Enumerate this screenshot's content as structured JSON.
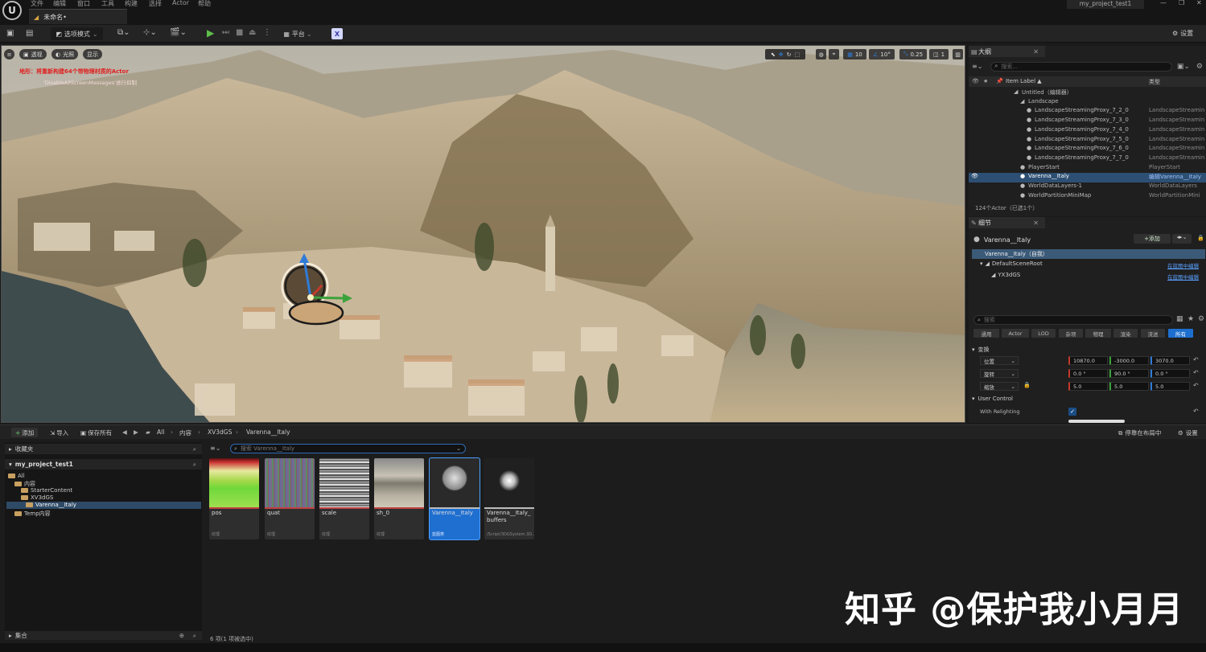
{
  "app": {
    "menu": [
      "文件",
      "编辑",
      "窗口",
      "工具",
      "构建",
      "选择",
      "Actor",
      "帮助"
    ],
    "doc_tab": "未命名•",
    "project_name": "my_project_test1",
    "window_controls": [
      "—",
      "❐",
      "✕"
    ]
  },
  "toolbar": {
    "mode": "选项模式",
    "platform": "平台",
    "settings": "设置"
  },
  "viewport": {
    "perspective": "透视",
    "lit": "光照",
    "show": "显示",
    "warning_title": "地形：将重新构建64个带物理材质的Actor",
    "warning_sub": "'DisableAllScreenMessages'进行抑制",
    "grid_size": "10",
    "rotation_snap": "10°",
    "scale_snap": "0.25",
    "camera_speed": "1"
  },
  "outliner": {
    "tab": "大纲",
    "search_placeholder": "搜索...",
    "col_label": "Item Label ▲",
    "col_type": "类型",
    "rows": [
      {
        "label": "Untitled（编辑器）",
        "type": ""
      },
      {
        "label": "Landscape",
        "type": ""
      },
      {
        "label": "LandscapeStreamingProxy_7_2_0",
        "type": "LandscapeStreamin"
      },
      {
        "label": "LandscapeStreamingProxy_7_3_0",
        "type": "LandscapeStreamin"
      },
      {
        "label": "LandscapeStreamingProxy_7_4_0",
        "type": "LandscapeStreamin"
      },
      {
        "label": "LandscapeStreamingProxy_7_5_0",
        "type": "LandscapeStreamin"
      },
      {
        "label": "LandscapeStreamingProxy_7_6_0",
        "type": "LandscapeStreamin"
      },
      {
        "label": "LandscapeStreamingProxy_7_7_0",
        "type": "LandscapeStreamin"
      },
      {
        "label": "PlayerStart",
        "type": "PlayerStart"
      },
      {
        "label": "Varenna__Italy",
        "type": "编辑Varenna__Italy"
      },
      {
        "label": "WorldDataLayers-1",
        "type": "WorldDataLayers"
      },
      {
        "label": "WorldPartitionMiniMap",
        "type": "WorldPartitionMini"
      }
    ],
    "footer": "124个Actor（已选1个）"
  },
  "details": {
    "tab": "细节",
    "actor_name": "Varenna__Italy",
    "add_label": "+添加",
    "self_row": "Varenna__Italy（自我）",
    "components": [
      {
        "name": "DefaultSceneRoot",
        "action": "在蓝图中编辑"
      },
      {
        "name": "YX3dGS",
        "action": "在蓝图中编辑"
      }
    ],
    "search_placeholder": "搜索",
    "filters": [
      "通用",
      "Actor",
      "LOD",
      "杂项",
      "物理",
      "渲染",
      "流送",
      "所有"
    ],
    "section_transform": "变换",
    "transform": [
      {
        "label": "位置",
        "x": "10870.0",
        "y": "-3000.0",
        "z": "3070.0"
      },
      {
        "label": "旋转",
        "x": "0.0 °",
        "y": "90.0 °",
        "z": "0.0 °"
      },
      {
        "label": "缩放",
        "x": "5.0",
        "y": "5.0",
        "z": "5.0"
      }
    ],
    "section_user": "User Control",
    "with_relighting": "With Relighting"
  },
  "content_browser": {
    "add": "添加",
    "import": "导入",
    "save_all": "保存所有",
    "path": [
      "All",
      "内容",
      "XV3dGS",
      "Varenna__Italy"
    ],
    "dock": "停靠在布局中",
    "settings": "设置",
    "favorites": "收藏夹",
    "project": "my_project_test1",
    "tree": [
      "All",
      "内容",
      "StarterContent",
      "XV3dGS",
      "Varenna__Italy",
      "Temp内容"
    ],
    "collections": "集合",
    "search_placeholder": "搜索 Varenna__Italy",
    "assets": [
      {
        "name": "pos",
        "type": "纹理"
      },
      {
        "name": "quat",
        "type": "纹理"
      },
      {
        "name": "scale",
        "type": "纹理"
      },
      {
        "name": "sh_0",
        "type": "纹理"
      },
      {
        "name": "Varenna__Italy",
        "type": "蓝图类"
      },
      {
        "name": "Varenna__Italy_buffers",
        "type": "/Script/3DGSystem.3D..."
      }
    ],
    "count": "6 项(1 项被选中)"
  },
  "watermark": "知乎 @保护我小月月"
}
